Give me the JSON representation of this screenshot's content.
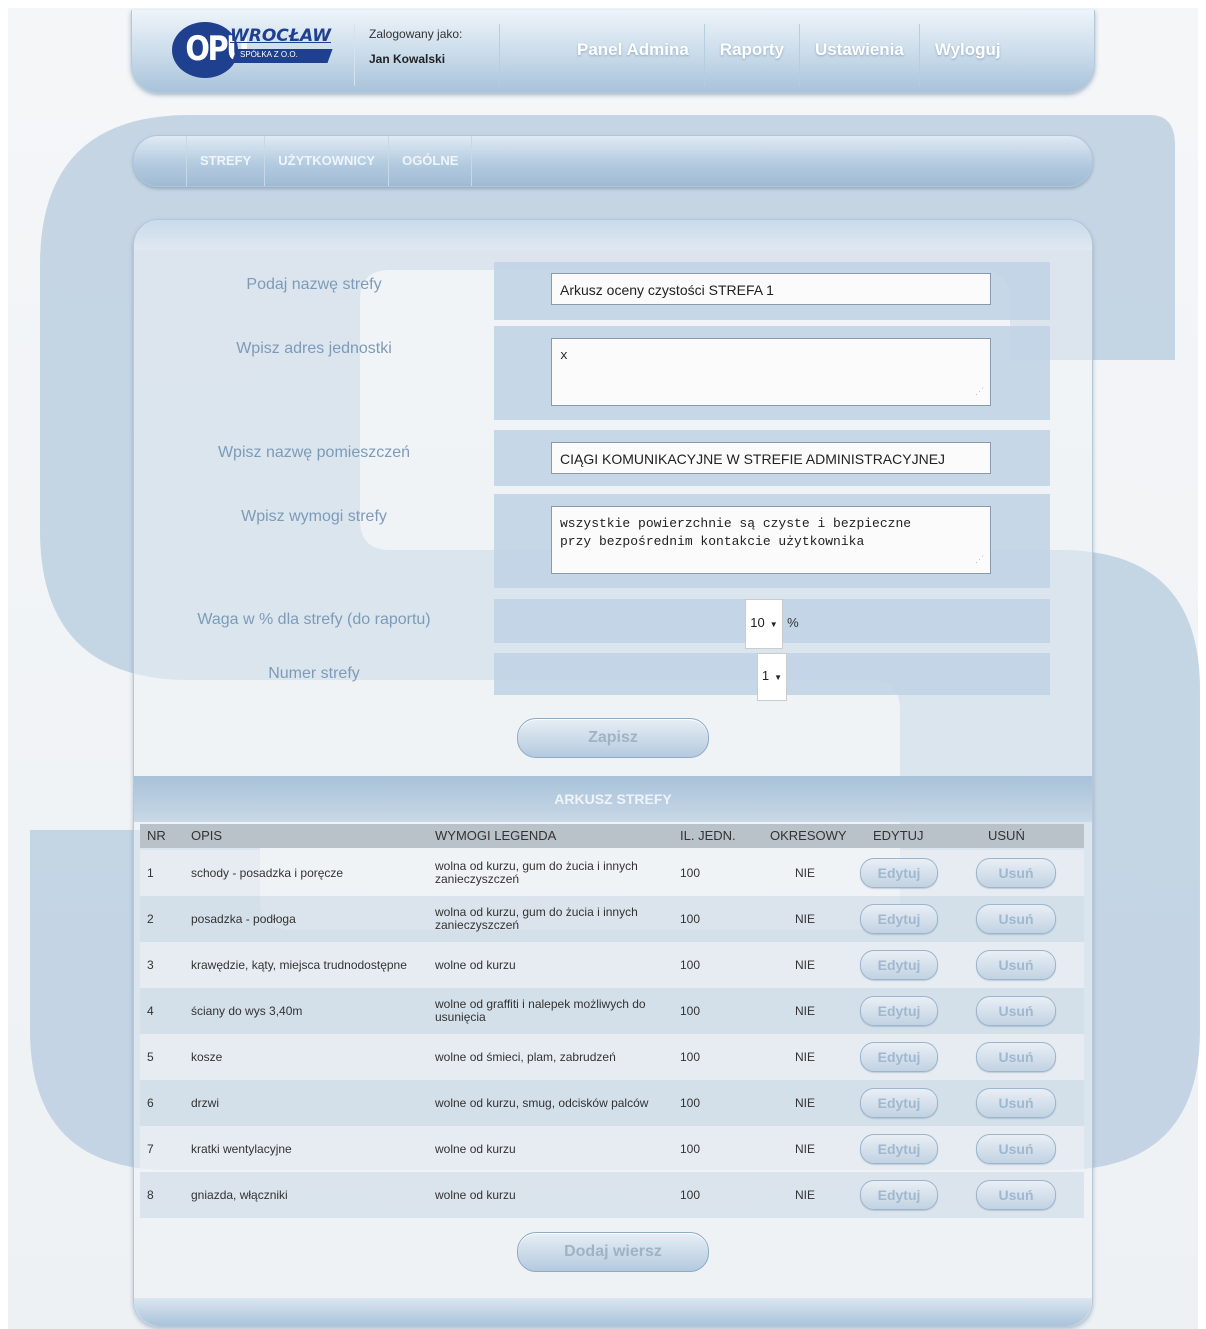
{
  "header": {
    "logo_letters": "OPU",
    "logo_city": "WROCŁAW",
    "logo_sub": "SPÓŁKA Z O.O.",
    "logged_in_label": "Zalogowany jako:",
    "user_name": "Jan Kowalski",
    "nav": [
      "Panel Admina",
      "Raporty",
      "Ustawienia",
      "Wyloguj"
    ]
  },
  "subnav": [
    "STREFY",
    "UŻYTKOWNICY",
    "OGÓLNE"
  ],
  "form": {
    "zone_name_label": "Podaj nazwę strefy",
    "zone_name_value": "Arkusz oceny czystości STREFA 1",
    "address_label": "Wpisz adres jednostki",
    "address_value": "x",
    "rooms_label": "Wpisz nazwę pomieszczeń",
    "rooms_value": "CIĄGI KOMUNIKACYJNE W STREFIE ADMINISTRACYJNEJ",
    "requirements_label": "Wpisz wymogi strefy",
    "requirements_value": "wszystkie powierzchnie są czyste i bezpieczne\nprzy bezpośrednim kontakcie użytkownika",
    "weight_label": "Waga w % dla strefy (do raportu)",
    "weight_value": "10",
    "weight_unit": "%",
    "number_label": "Numer strefy",
    "number_value": "1",
    "save_label": "Zapisz"
  },
  "sheet": {
    "title": "ARKUSZ STREFY",
    "columns": [
      "NR",
      "OPIS",
      "WYMOGI LEGENDA",
      "IL. JEDN.",
      "OKRESOWY",
      "EDYTUJ",
      "USUŃ"
    ],
    "edit_label": "Edytuj",
    "delete_label": "Usuń",
    "rows": [
      {
        "nr": "1",
        "opis": "schody - posadzka i poręcze",
        "wymogi": "wolna od kurzu, gum do żucia i innych zanieczyszczeń",
        "il": "100",
        "okresowy": "NIE"
      },
      {
        "nr": "2",
        "opis": "posadzka - podłoga",
        "wymogi": "wolna od kurzu, gum do żucia i innych zanieczyszczeń",
        "il": "100",
        "okresowy": "NIE"
      },
      {
        "nr": "3",
        "opis": "krawędzie, kąty, miejsca trudnodostępne",
        "wymogi": "wolne od kurzu",
        "il": "100",
        "okresowy": "NIE"
      },
      {
        "nr": "4",
        "opis": "ściany do wys 3,40m",
        "wymogi": "wolne od graffiti i nalepek możliwych do usunięcia",
        "il": "100",
        "okresowy": "NIE"
      },
      {
        "nr": "5",
        "opis": "kosze",
        "wymogi": "wolne od śmieci, plam, zabrudzeń",
        "il": "100",
        "okresowy": "NIE"
      },
      {
        "nr": "6",
        "opis": "drzwi",
        "wymogi": "wolne od kurzu, smug, odcisków palców",
        "il": "100",
        "okresowy": "NIE"
      },
      {
        "nr": "7",
        "opis": "kratki wentylacyjne",
        "wymogi": "wolne od kurzu",
        "il": "100",
        "okresowy": "NIE"
      },
      {
        "nr": "8",
        "opis": "gniazda, włączniki",
        "wymogi": "wolne od kurzu",
        "il": "100",
        "okresowy": "NIE"
      }
    ],
    "add_row_label": "Dodaj wiersz"
  },
  "colors": {
    "brand": "#1f3f8f",
    "header_blue": "#a8c3da",
    "bg_s_shape": "#bccfe1"
  }
}
